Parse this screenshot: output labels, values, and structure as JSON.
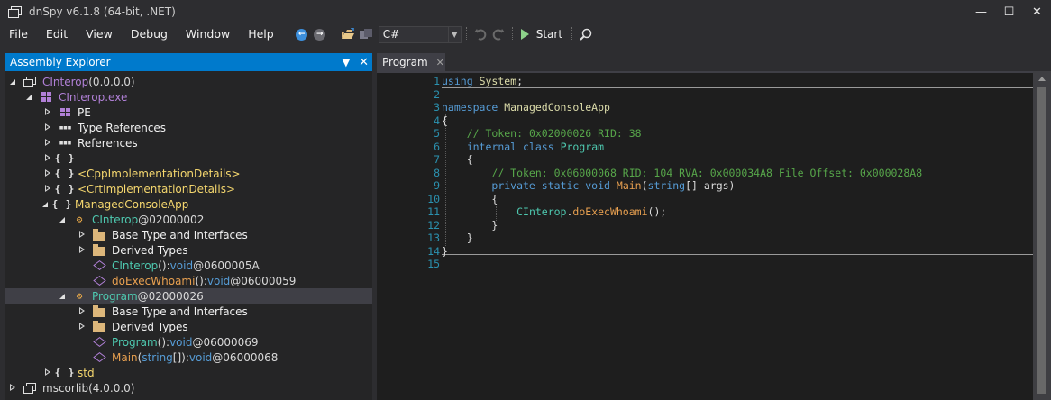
{
  "window": {
    "title": "dnSpy v6.1.8 (64-bit, .NET)",
    "minimize": "—",
    "maximize": "☐",
    "close": "✕"
  },
  "menu": {
    "items": [
      "File",
      "Edit",
      "View",
      "Debug",
      "Window",
      "Help"
    ]
  },
  "toolbar": {
    "language": "C#",
    "start_label": "Start"
  },
  "explorer": {
    "title": "Assembly Explorer",
    "nodes": [
      {
        "label": "CInterop",
        "suffix": " (0.0.0.0)"
      },
      {
        "label": "CInterop.exe"
      },
      {
        "label": "PE"
      },
      {
        "label": "Type References"
      },
      {
        "label": "References"
      },
      {
        "label": "-"
      },
      {
        "label": "<CppImplementationDetails>"
      },
      {
        "label": "<CrtImplementationDetails>"
      },
      {
        "label": "ManagedConsoleApp"
      },
      {
        "label": "CInterop",
        "suffix": " @02000002"
      },
      {
        "label": "Base Type and Interfaces"
      },
      {
        "label": "Derived Types"
      },
      {
        "label": "CInterop",
        "sig": "()",
        "colon": " : ",
        "ret": "void",
        "token": " @0600005A"
      },
      {
        "label": "doExecWhoami",
        "sig": "()",
        "colon": " : ",
        "ret": "void",
        "token": " @06000059"
      },
      {
        "label": "Program",
        "suffix": " @02000026"
      },
      {
        "label": "Base Type and Interfaces"
      },
      {
        "label": "Derived Types"
      },
      {
        "label": "Program",
        "sig": "()",
        "colon": " : ",
        "ret": "void",
        "token": " @06000069"
      },
      {
        "label": "Main",
        "sig_open": "(",
        "sig_type": "string",
        "sig_close": "[])",
        "colon": " : ",
        "ret": "void",
        "token": " @06000068"
      },
      {
        "label": "std"
      },
      {
        "label": "mscorlib",
        "suffix": " (4.0.0.0)"
      }
    ]
  },
  "editor": {
    "tab_label": "Program",
    "line_numbers": [
      "1",
      "2",
      "3",
      "4",
      "5",
      "6",
      "7",
      "8",
      "9",
      "10",
      "11",
      "12",
      "13",
      "14",
      "15"
    ],
    "code": {
      "l1_using": "using",
      "l1_ns": "System",
      "l1_semi": ";",
      "l3_kw": "namespace",
      "l3_name": "ManagedConsoleApp",
      "l4": "{",
      "l5": "// Token: 0x02000026 RID: 38",
      "l6_kw": "internal class",
      "l6_name": "Program",
      "l7": "{",
      "l8": "// Token: 0x06000068 RID: 104 RVA: 0x000034A8 File Offset: 0x000028A8",
      "l9_kw": "private static void",
      "l9_name": "Main",
      "l9_open": "(",
      "l9_type": "string",
      "l9_rest": "[] args)",
      "l10": "{",
      "l11_type": "CInterop",
      "l11_dot": ".",
      "l11_method": "doExecWhoami",
      "l11_rest": "();",
      "l12": "}",
      "l13": "}",
      "l14": "}"
    }
  }
}
